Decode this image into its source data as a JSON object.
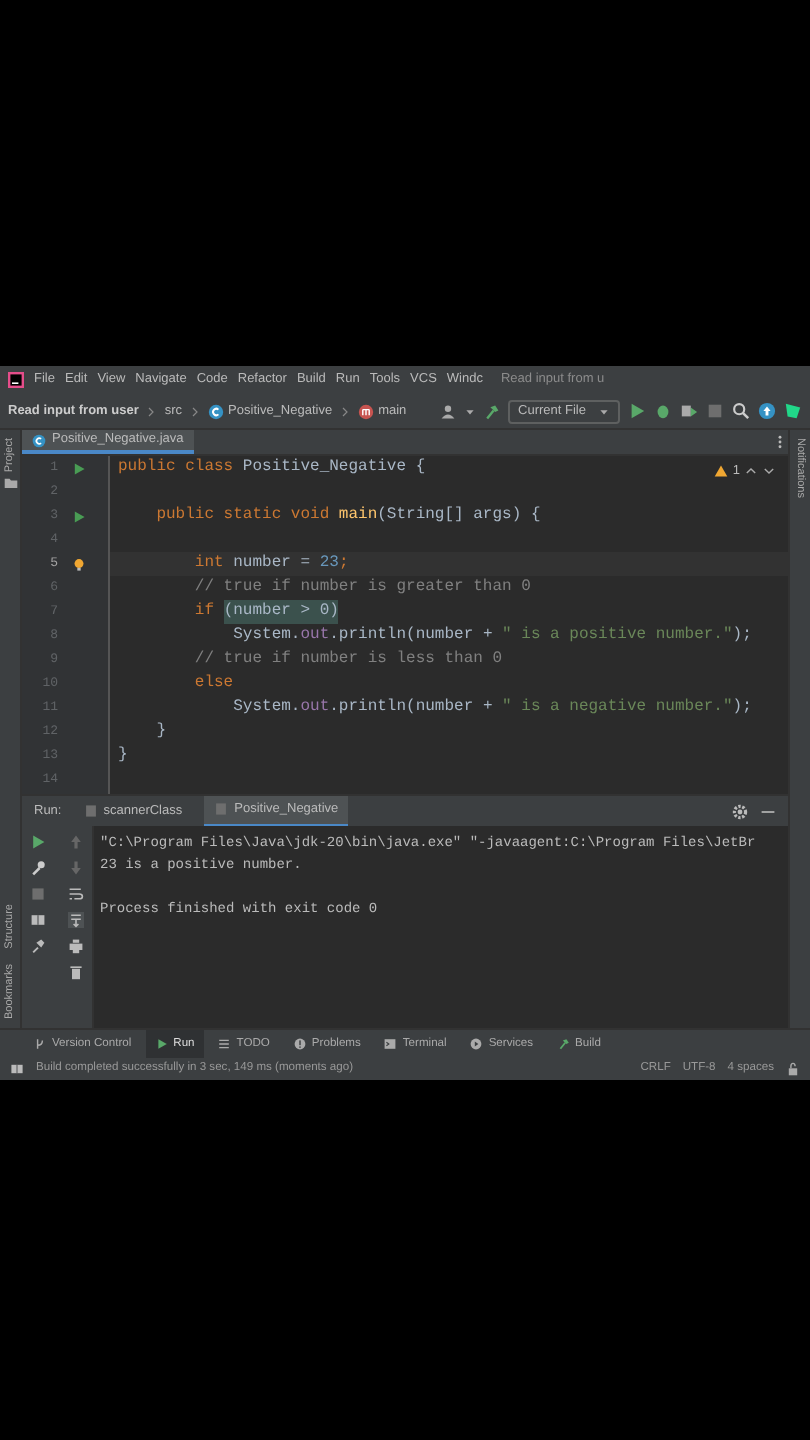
{
  "menu_bar": {
    "items": [
      "File",
      "Edit",
      "View",
      "Navigate",
      "Code",
      "Refactor",
      "Build",
      "Run",
      "Tools",
      "VCS",
      "Windc"
    ],
    "title": "Read input from u"
  },
  "toolbar": {
    "breadcrumbs": [
      {
        "label": "Read input from user",
        "kind": "project"
      },
      {
        "label": "src",
        "kind": "folder"
      },
      {
        "label": "Positive_Negative",
        "kind": "class"
      },
      {
        "label": "main",
        "kind": "method"
      }
    ],
    "run_config": "Current File"
  },
  "left_stripe": {
    "top": "Project",
    "bottom": [
      "Structure",
      "Bookmarks"
    ]
  },
  "right_stripe": "Notifications",
  "editor_tabs": [
    {
      "label": "Positive_Negative.java",
      "selected": true
    }
  ],
  "editor": {
    "warnings": "1",
    "lines": [
      {
        "number": "1",
        "current": false,
        "gutter": {
          "kind": "run"
        },
        "tokens": [
          {
            "text": "public class ",
            "kind": "kw"
          },
          {
            "text": "Positive_Negative {",
            "kind": "plain"
          }
        ]
      },
      {
        "number": "2",
        "current": false
      },
      {
        "number": "3",
        "current": false,
        "gutter": {
          "kind": "run"
        },
        "tokens": [
          {
            "text": "    public static void ",
            "kind": "kw"
          },
          {
            "text": "main",
            "kind": "fn"
          },
          {
            "text": "(String[] args) {",
            "kind": "plain"
          }
        ]
      },
      {
        "number": "4",
        "current": false
      },
      {
        "number": "5",
        "current": true,
        "gutter": {
          "kind": "bulb"
        },
        "tokens": [
          {
            "text": "        int ",
            "kind": "kw"
          },
          {
            "text": "number = ",
            "kind": "plain"
          },
          {
            "text": "23",
            "kind": "num"
          },
          {
            "text": ";",
            "kind": "kw"
          }
        ]
      },
      {
        "number": "6",
        "current": false,
        "tokens": [
          {
            "text": "        // true if number is greater than 0",
            "kind": "comment"
          }
        ]
      },
      {
        "number": "7",
        "current": false,
        "tokens": [
          {
            "text": "        if ",
            "kind": "kw"
          },
          {
            "text": "(number > 0)",
            "kind": "match"
          }
        ]
      },
      {
        "number": "8",
        "current": false,
        "tokens": [
          {
            "text": "            System.",
            "kind": "plain"
          },
          {
            "text": "out",
            "kind": "field"
          },
          {
            "text": ".println(number + ",
            "kind": "plain"
          },
          {
            "text": "\" is a positive number.\"",
            "kind": "str"
          },
          {
            "text": ");",
            "kind": "plain"
          }
        ]
      },
      {
        "number": "9",
        "current": false,
        "tokens": [
          {
            "text": "        // true if number is less than 0",
            "kind": "comment"
          }
        ]
      },
      {
        "number": "10",
        "current": false,
        "tokens": [
          {
            "text": "        else",
            "kind": "kw"
          }
        ]
      },
      {
        "number": "11",
        "current": false,
        "tokens": [
          {
            "text": "            System.",
            "kind": "plain"
          },
          {
            "text": "out",
            "kind": "field"
          },
          {
            "text": ".println(number + ",
            "kind": "plain"
          },
          {
            "text": "\" is a negative number.\"",
            "kind": "str"
          },
          {
            "text": ");",
            "kind": "plain"
          }
        ]
      },
      {
        "number": "12",
        "current": false,
        "tokens": [
          {
            "text": "    }",
            "kind": "plain"
          }
        ]
      },
      {
        "number": "13",
        "current": false,
        "tokens": [
          {
            "text": "}",
            "kind": "plain"
          }
        ]
      },
      {
        "number": "14",
        "current": false
      }
    ]
  },
  "run_panel": {
    "label": "Run:",
    "tabs": [
      {
        "label": "scannerClass",
        "selected": false
      },
      {
        "label": "Positive_Negative",
        "selected": true
      }
    ],
    "console": [
      {
        "text": "\"C:\\Program Files\\Java\\jdk-20\\bin\\java.exe\" \"-javaagent:C:\\Program Files\\JetBr",
        "kind": "command"
      },
      {
        "text": "23 is a positive number.",
        "kind": "output"
      },
      {
        "text": "Process finished with exit code 0",
        "kind": "exit"
      }
    ]
  },
  "bottom_tabs": [
    {
      "label": "Version Control",
      "kind": "vcs",
      "selected": false
    },
    {
      "label": "Run",
      "kind": "run",
      "selected": true
    },
    {
      "label": "TODO",
      "kind": "todo",
      "selected": false
    },
    {
      "label": "Problems",
      "kind": "problems",
      "selected": false
    },
    {
      "label": "Terminal",
      "kind": "terminal",
      "selected": false
    },
    {
      "label": "Services",
      "kind": "services",
      "selected": false
    },
    {
      "label": "Build",
      "kind": "build",
      "selected": false
    }
  ],
  "status_bar": {
    "message": "Build completed successfully in 3 sec, 149 ms (moments ago)",
    "items": [
      "CRLF",
      "UTF-8",
      "4 spaces"
    ]
  }
}
